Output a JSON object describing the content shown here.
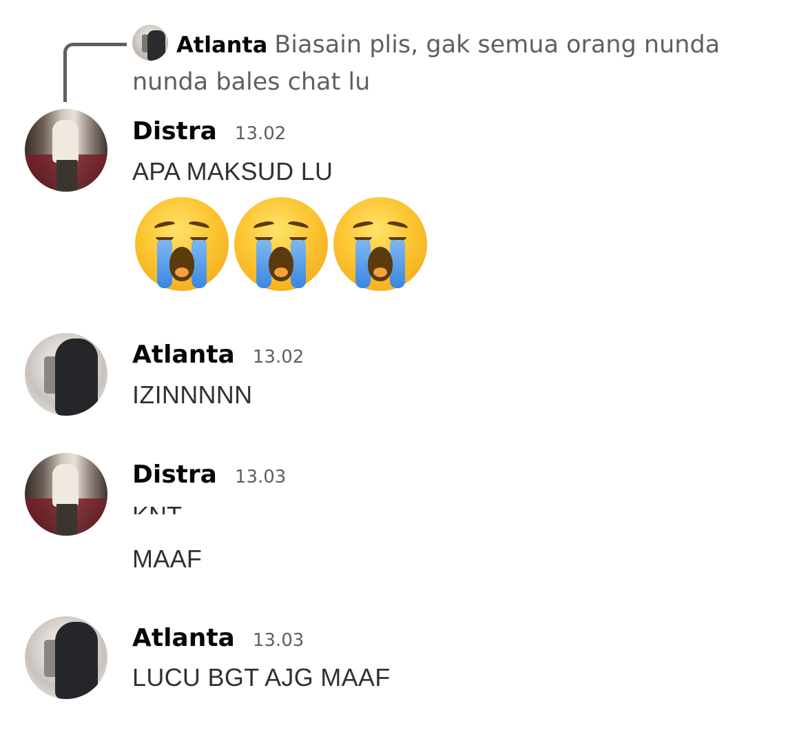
{
  "reply": {
    "author": "Atlanta",
    "text": "Biasain plis, gak semua orang nunda nunda bales chat lu"
  },
  "messages": [
    {
      "author": "Distra",
      "time": "13.02",
      "text": "APA MAKSUD LU",
      "emoji": [
        "loudly-crying-face",
        "loudly-crying-face",
        "loudly-crying-face"
      ]
    },
    {
      "author": "Atlanta",
      "time": "13.02",
      "text": "IZINNNNN"
    },
    {
      "author": "Distra",
      "time": "13.03",
      "text_cut": "KNT",
      "text": "MAAF"
    },
    {
      "author": "Atlanta",
      "time": "13.03",
      "text": "LUCU BGT AJG MAAF"
    }
  ]
}
